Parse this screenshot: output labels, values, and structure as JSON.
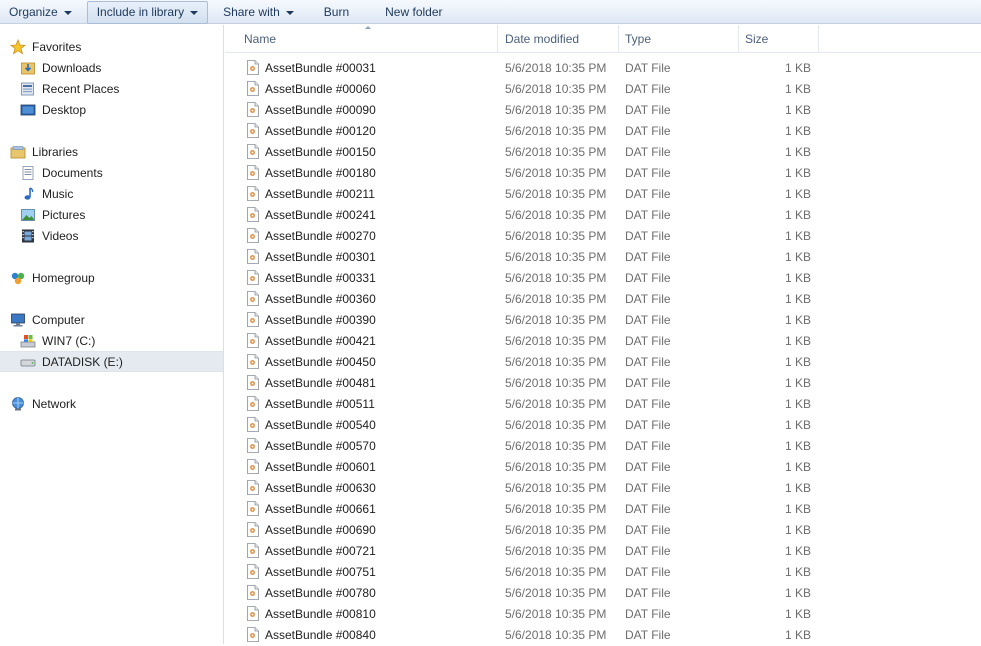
{
  "toolbar": {
    "organize": "Organize",
    "include_in_library": "Include in library",
    "share_with": "Share with",
    "burn": "Burn",
    "new_folder": "New folder"
  },
  "nav": {
    "favorites": "Favorites",
    "downloads": "Downloads",
    "recent_places": "Recent Places",
    "desktop": "Desktop",
    "libraries": "Libraries",
    "documents": "Documents",
    "music": "Music",
    "pictures": "Pictures",
    "videos": "Videos",
    "homegroup": "Homegroup",
    "computer": "Computer",
    "win7": "WIN7 (C:)",
    "datadisk": "DATADISK (E:)",
    "network": "Network"
  },
  "columns": {
    "name": "Name",
    "date_modified": "Date modified",
    "type": "Type",
    "size": "Size"
  },
  "files": [
    {
      "name": "AssetBundle #00031",
      "date": "5/6/2018 10:35 PM",
      "type": "DAT File",
      "size": "1 KB"
    },
    {
      "name": "AssetBundle #00060",
      "date": "5/6/2018 10:35 PM",
      "type": "DAT File",
      "size": "1 KB"
    },
    {
      "name": "AssetBundle #00090",
      "date": "5/6/2018 10:35 PM",
      "type": "DAT File",
      "size": "1 KB"
    },
    {
      "name": "AssetBundle #00120",
      "date": "5/6/2018 10:35 PM",
      "type": "DAT File",
      "size": "1 KB"
    },
    {
      "name": "AssetBundle #00150",
      "date": "5/6/2018 10:35 PM",
      "type": "DAT File",
      "size": "1 KB"
    },
    {
      "name": "AssetBundle #00180",
      "date": "5/6/2018 10:35 PM",
      "type": "DAT File",
      "size": "1 KB"
    },
    {
      "name": "AssetBundle #00211",
      "date": "5/6/2018 10:35 PM",
      "type": "DAT File",
      "size": "1 KB"
    },
    {
      "name": "AssetBundle #00241",
      "date": "5/6/2018 10:35 PM",
      "type": "DAT File",
      "size": "1 KB"
    },
    {
      "name": "AssetBundle #00270",
      "date": "5/6/2018 10:35 PM",
      "type": "DAT File",
      "size": "1 KB"
    },
    {
      "name": "AssetBundle #00301",
      "date": "5/6/2018 10:35 PM",
      "type": "DAT File",
      "size": "1 KB"
    },
    {
      "name": "AssetBundle #00331",
      "date": "5/6/2018 10:35 PM",
      "type": "DAT File",
      "size": "1 KB"
    },
    {
      "name": "AssetBundle #00360",
      "date": "5/6/2018 10:35 PM",
      "type": "DAT File",
      "size": "1 KB"
    },
    {
      "name": "AssetBundle #00390",
      "date": "5/6/2018 10:35 PM",
      "type": "DAT File",
      "size": "1 KB"
    },
    {
      "name": "AssetBundle #00421",
      "date": "5/6/2018 10:35 PM",
      "type": "DAT File",
      "size": "1 KB"
    },
    {
      "name": "AssetBundle #00450",
      "date": "5/6/2018 10:35 PM",
      "type": "DAT File",
      "size": "1 KB"
    },
    {
      "name": "AssetBundle #00481",
      "date": "5/6/2018 10:35 PM",
      "type": "DAT File",
      "size": "1 KB"
    },
    {
      "name": "AssetBundle #00511",
      "date": "5/6/2018 10:35 PM",
      "type": "DAT File",
      "size": "1 KB"
    },
    {
      "name": "AssetBundle #00540",
      "date": "5/6/2018 10:35 PM",
      "type": "DAT File",
      "size": "1 KB"
    },
    {
      "name": "AssetBundle #00570",
      "date": "5/6/2018 10:35 PM",
      "type": "DAT File",
      "size": "1 KB"
    },
    {
      "name": "AssetBundle #00601",
      "date": "5/6/2018 10:35 PM",
      "type": "DAT File",
      "size": "1 KB"
    },
    {
      "name": "AssetBundle #00630",
      "date": "5/6/2018 10:35 PM",
      "type": "DAT File",
      "size": "1 KB"
    },
    {
      "name": "AssetBundle #00661",
      "date": "5/6/2018 10:35 PM",
      "type": "DAT File",
      "size": "1 KB"
    },
    {
      "name": "AssetBundle #00690",
      "date": "5/6/2018 10:35 PM",
      "type": "DAT File",
      "size": "1 KB"
    },
    {
      "name": "AssetBundle #00721",
      "date": "5/6/2018 10:35 PM",
      "type": "DAT File",
      "size": "1 KB"
    },
    {
      "name": "AssetBundle #00751",
      "date": "5/6/2018 10:35 PM",
      "type": "DAT File",
      "size": "1 KB"
    },
    {
      "name": "AssetBundle #00780",
      "date": "5/6/2018 10:35 PM",
      "type": "DAT File",
      "size": "1 KB"
    },
    {
      "name": "AssetBundle #00810",
      "date": "5/6/2018 10:35 PM",
      "type": "DAT File",
      "size": "1 KB"
    },
    {
      "name": "AssetBundle #00840",
      "date": "5/6/2018 10:35 PM",
      "type": "DAT File",
      "size": "1 KB"
    }
  ]
}
